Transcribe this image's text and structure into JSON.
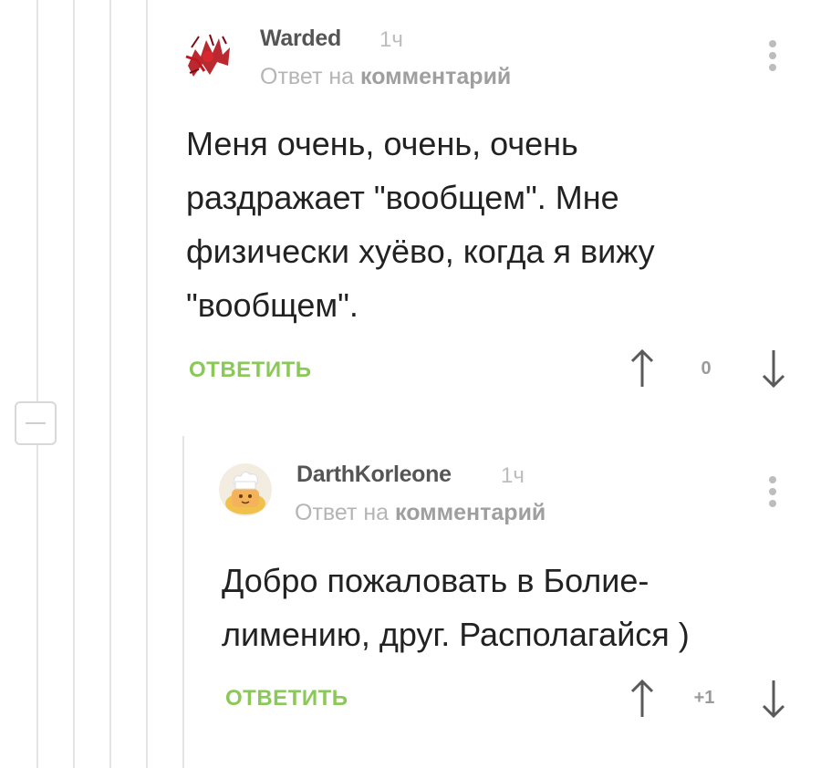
{
  "comments": [
    {
      "author": "Warded",
      "time": "1ч",
      "reply_prefix": "Ответ на",
      "reply_link": "комментарий",
      "body": [
        "Меня очень, очень, очень",
        "раздражает \"вообщем\". Мне",
        "физически хуёво, когда я вижу",
        "\"вообщем\"."
      ],
      "reply_label": "ОТВЕТИТЬ",
      "score": "0",
      "avatar_icon": "red-sketch-avatar-icon"
    },
    {
      "author": "DarthKorleone",
      "time": "1ч",
      "reply_prefix": "Ответ на",
      "reply_link": "комментарий",
      "body": [
        "Добро пожаловать в Болие-",
        "лимению, друг. Располагайся )"
      ],
      "reply_label": "ОТВЕТИТЬ",
      "score": "+1",
      "avatar_icon": "chef-avatar-icon"
    }
  ],
  "colors": {
    "accent_green": "#8ac858",
    "thread_line": "#e4e4e4",
    "meta_gray": "#b5b5b5"
  }
}
